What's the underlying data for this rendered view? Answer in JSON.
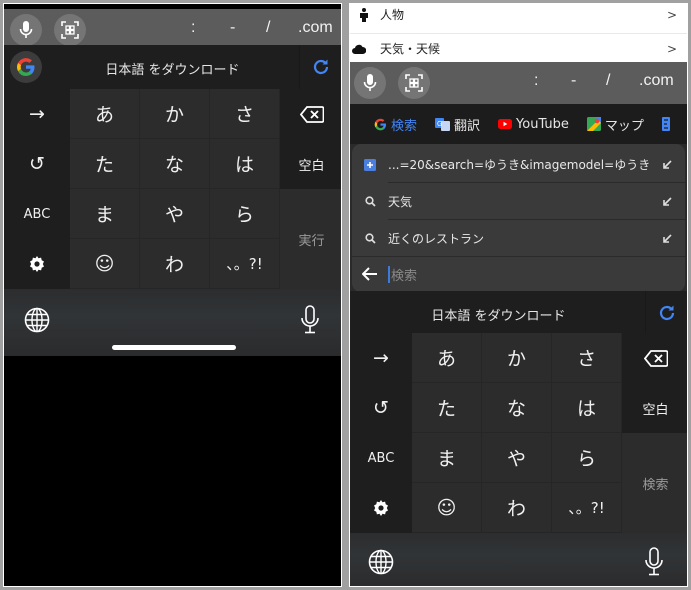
{
  "left_panel": {
    "toolbar": {
      "mic_icon": "microphone-icon",
      "scan_icon": "scan-icon",
      "symbols": [
        ":",
        "-",
        "/",
        ".com"
      ]
    },
    "download_bar": {
      "google_icon": "google-g-icon",
      "text": "日本語 をダウンロード",
      "refresh_icon": "refresh-icon"
    },
    "keyboard": {
      "rows": [
        {
          "left": "→",
          "keys": [
            "あ",
            "か",
            "さ"
          ],
          "right": "⌫"
        },
        {
          "left": "↺",
          "keys": [
            "た",
            "な",
            "は"
          ],
          "right": "空白"
        },
        {
          "left": "ABC",
          "keys": [
            "ま",
            "や",
            "ら"
          ]
        },
        {
          "left": "⚙",
          "keys": [
            "☺",
            "わ",
            "、。?!"
          ]
        }
      ],
      "action": "実行"
    },
    "bottom": {
      "globe_icon": "globe-icon",
      "dictation_icon": "microphone-icon"
    }
  },
  "right_panel": {
    "list": [
      {
        "icon": "person-icon",
        "label": "人物",
        "chevron": ">"
      },
      {
        "icon": "cloud-icon",
        "label": "天気・天候",
        "chevron": ">"
      }
    ],
    "toolbar": {
      "symbols": [
        ":",
        "-",
        "/",
        ".com"
      ]
    },
    "quick_links": [
      {
        "icon": "google-g-icon",
        "label": "検索",
        "color": "#4285f4"
      },
      {
        "icon": "translate-icon",
        "label": "翻訳",
        "color": "#e6e6e6"
      },
      {
        "icon": "youtube-icon",
        "label": "YouTube",
        "color": "#e6e6e6"
      },
      {
        "icon": "maps-icon",
        "label": "マップ",
        "color": "#e6e6e6"
      }
    ],
    "suggestions": [
      {
        "icon": "bookmark-plus-icon",
        "text": "...=20&search=ゆうき&imagemodel=ゆうき"
      },
      {
        "icon": "search-icon",
        "text": "天気"
      },
      {
        "icon": "search-icon",
        "text": "近くのレストラン"
      }
    ],
    "search_input": {
      "placeholder": "検索",
      "value": ""
    },
    "download_bar": {
      "text": "日本語 をダウンロード"
    },
    "keyboard": {
      "rows": [
        {
          "left": "→",
          "keys": [
            "あ",
            "か",
            "さ"
          ],
          "right": "⌫"
        },
        {
          "left": "↺",
          "keys": [
            "た",
            "な",
            "は"
          ],
          "right": "空白"
        },
        {
          "left": "ABC",
          "keys": [
            "ま",
            "や",
            "ら"
          ]
        },
        {
          "left": "⚙",
          "keys": [
            "☺",
            "わ",
            "、。?!"
          ]
        }
      ],
      "action": "検索"
    }
  },
  "colors": {
    "accent_blue": "#4285f4",
    "youtube_red": "#ff0000"
  }
}
